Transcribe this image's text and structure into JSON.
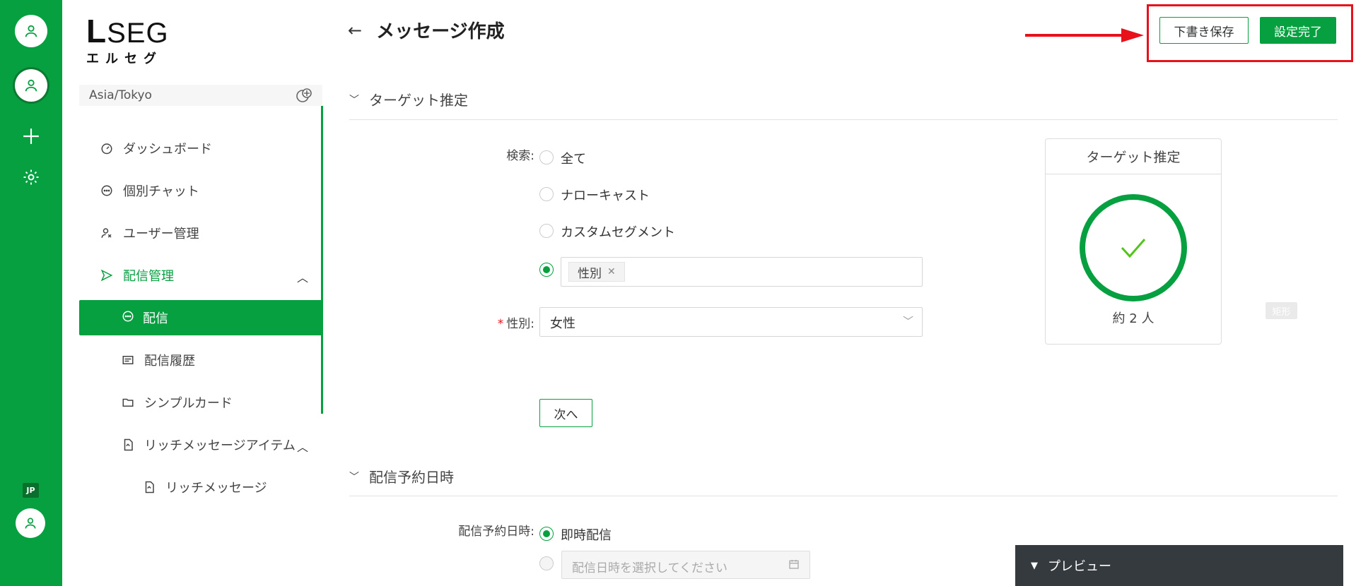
{
  "sidebar": {
    "logo": {
      "mark": "L",
      "text": "SEG",
      "sub": "エルセグ"
    },
    "timezone": "Asia/Tokyo",
    "items": [
      {
        "label": "ダッシュボード"
      },
      {
        "label": "個別チャット"
      },
      {
        "label": "ユーザー管理"
      },
      {
        "label": "配信管理"
      },
      {
        "label": "配信"
      },
      {
        "label": "配信履歴"
      },
      {
        "label": "シンプルカード"
      },
      {
        "label": "リッチメッセージアイテム"
      },
      {
        "label": "リッチメッセージ"
      }
    ],
    "lang_badge": "JP"
  },
  "header": {
    "title": "メッセージ作成",
    "save_draft_label": "下書き保存",
    "complete_label": "設定完了"
  },
  "target_section": {
    "title": "ターゲット推定",
    "search_label": "検索:",
    "options": [
      "全て",
      "ナローキャスト",
      "カスタムセグメント"
    ],
    "tag": "性別",
    "gender_label": "性別:",
    "gender_value": "女性",
    "next_label": "次へ",
    "card_title": "ターゲット推定",
    "count_text": "約 2 人",
    "ghost_label": "矩形"
  },
  "schedule_section": {
    "title": "配信予約日時",
    "label": "配信予約日時:",
    "immediate_label": "即時配信",
    "date_placeholder": "配信日時を選択してください"
  },
  "preview": {
    "label": "プレビュー"
  },
  "colors": {
    "brand_green": "#06a040",
    "highlight_red": "#e8101a",
    "preview_bg": "#343a3e"
  }
}
